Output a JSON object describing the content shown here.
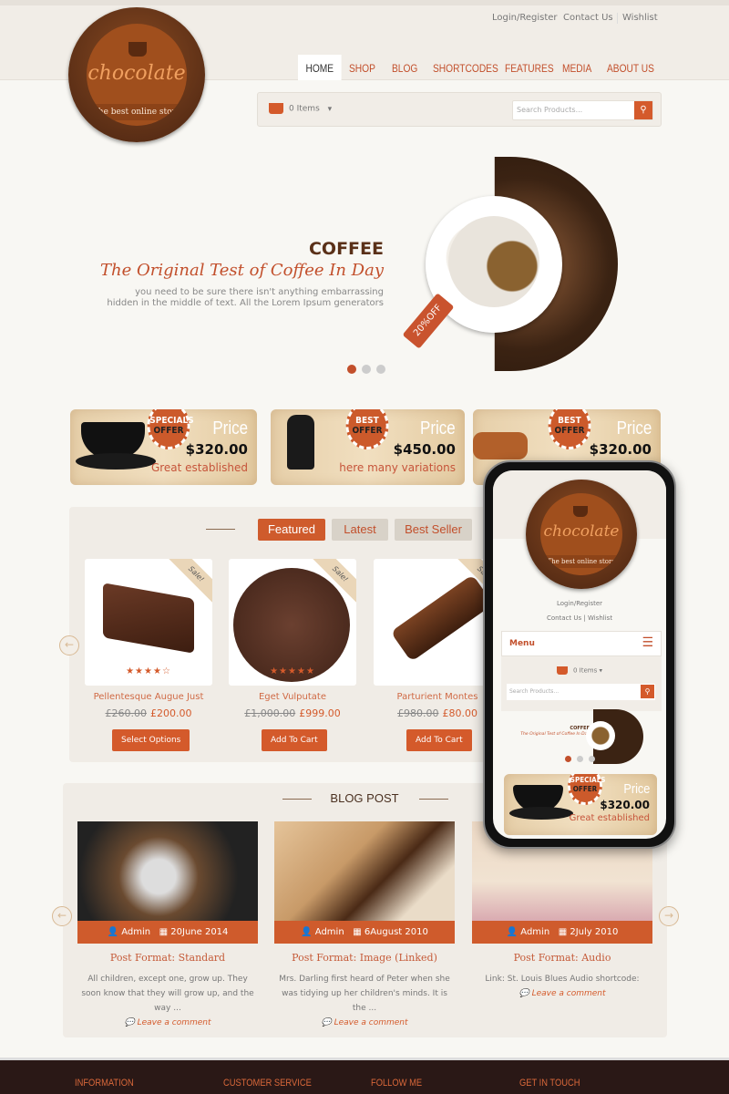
{
  "logo": {
    "name": "chocolate",
    "tagline": "The best online store"
  },
  "top_links": [
    "Login/Register",
    "Contact Us",
    "Wishlist"
  ],
  "nav": [
    {
      "label": "HOME",
      "active": true
    },
    {
      "label": "SHOP"
    },
    {
      "label": "BLOG"
    },
    {
      "label": "SHORTCODES"
    },
    {
      "label": "FEATURES"
    },
    {
      "label": "MEDIA"
    },
    {
      "label": "ABOUT US"
    }
  ],
  "cart": {
    "label": "0 Items"
  },
  "search": {
    "placeholder": "Search Products..."
  },
  "hero": {
    "title": "COFFEE",
    "subtitle": "The Original Test of Coffee In Day",
    "line1": "you need to be sure there isn't anything embarrassing",
    "line2": "hidden in the middle of text. All the Lorem Ipsum generators",
    "tag": "20%OFF",
    "slides": 3,
    "active_slide": 1
  },
  "offers": [
    {
      "badge1": "SPECIALS",
      "badge2": "OFFER",
      "price_label": "Price",
      "price": "$320.00",
      "text": "Great established"
    },
    {
      "badge1": "BEST",
      "badge2": "OFFER",
      "price_label": "Price",
      "price": "$450.00",
      "text": "here many variations"
    },
    {
      "badge1": "BEST",
      "badge2": "OFFER",
      "price_label": "Price",
      "price": "$320.00",
      "text": ""
    }
  ],
  "product_tabs": [
    "Featured",
    "Latest",
    "Best Seller"
  ],
  "products": [
    {
      "name": "Pellentesque Augue Just",
      "old": "£260.00",
      "price": "£200.00",
      "button": "Select Options",
      "rating": 4,
      "sale": "Sale!"
    },
    {
      "name": "Eget Vulputate",
      "old": "£1,000.00",
      "price": "£999.00",
      "button": "Add To Cart",
      "rating": 5,
      "sale": "Sale!"
    },
    {
      "name": "Parturient Montes",
      "old": "£980.00",
      "price": "£80.00",
      "button": "Add To Cart",
      "rating": 0,
      "sale": "Sale!"
    }
  ],
  "blog": {
    "title": "BLOG POST",
    "posts": [
      {
        "author": "Admin",
        "date": "20June 2014",
        "title": "Post Format: Standard",
        "excerpt": "All children, except one, grow up. They soon know that they will grow up, and the way ...",
        "comment": "Leave a comment"
      },
      {
        "author": "Admin",
        "date": "6August 2010",
        "title": "Post Format: Image (Linked)",
        "excerpt": "Mrs. Darling first heard of Peter when she was tidying up her children's minds. It is the ...",
        "comment": "Leave a comment"
      },
      {
        "author": "Admin",
        "date": "2July 2010",
        "title": "Post Format: Audio",
        "excerpt": "Link: St. Louis Blues Audio shortcode:",
        "comment": "Leave a comment"
      }
    ]
  },
  "footer": [
    "INFORMATION",
    "CUSTOMER SERVICE",
    "FOLLOW ME",
    "GET IN TOUCH"
  ],
  "phone": {
    "menu": "Menu",
    "login": "Login/Register",
    "contact": "Contact Us",
    "wishlist": "Wishlist",
    "cart": "0 Items",
    "search": "Search Products...",
    "hero_title": "COFFEE",
    "hero_sub": "The Original Test of Coffee In Day",
    "offer": {
      "badge1": "SPECIALS",
      "badge2": "OFFER",
      "price_label": "Price",
      "price": "$320.00",
      "text": "Great established"
    }
  },
  "colors": {
    "accent": "#d45a2b",
    "brown": "#5c2f16",
    "footer": "#2a1816"
  }
}
